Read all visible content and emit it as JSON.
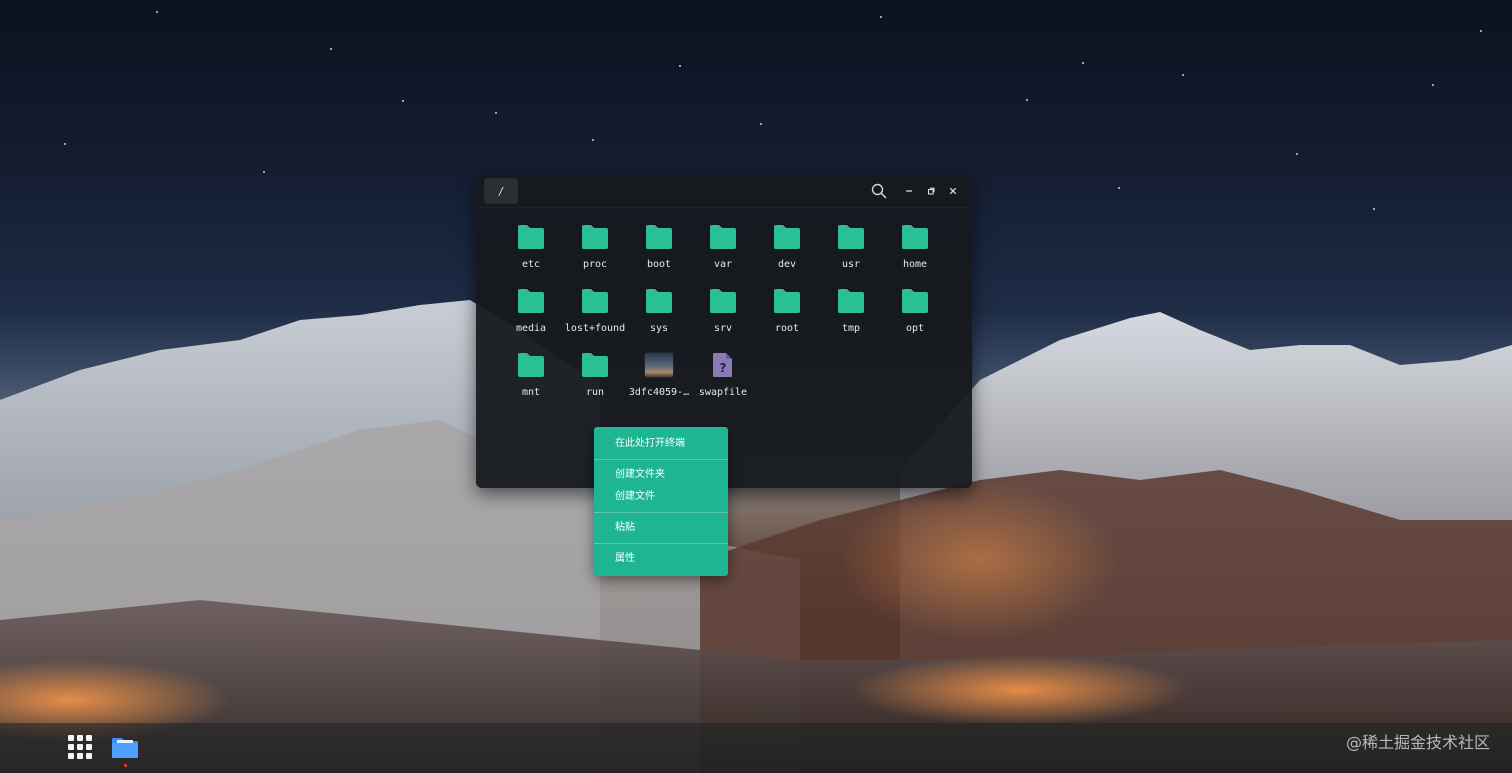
{
  "colors": {
    "accent": "#1DB592",
    "folder": "#2BBF95",
    "file_icon": "#8A7BB8",
    "window_bg": "#16191D",
    "menu_text": "#FFFFFF"
  },
  "file_manager": {
    "path": "/",
    "controls": {
      "search_icon": "search-icon",
      "minimize_icon": "minimize-icon",
      "restore_icon": "restore-icon",
      "close_icon": "close-icon"
    },
    "items": [
      {
        "name": "etc",
        "kind": "folder"
      },
      {
        "name": "proc",
        "kind": "folder"
      },
      {
        "name": "boot",
        "kind": "folder"
      },
      {
        "name": "var",
        "kind": "folder"
      },
      {
        "name": "dev",
        "kind": "folder"
      },
      {
        "name": "usr",
        "kind": "folder"
      },
      {
        "name": "home",
        "kind": "folder"
      },
      {
        "name": "media",
        "kind": "folder"
      },
      {
        "name": "lost+found",
        "kind": "folder"
      },
      {
        "name": "sys",
        "kind": "folder"
      },
      {
        "name": "srv",
        "kind": "folder"
      },
      {
        "name": "root",
        "kind": "folder"
      },
      {
        "name": "tmp",
        "kind": "folder"
      },
      {
        "name": "opt",
        "kind": "folder"
      },
      {
        "name": "mnt",
        "kind": "folder"
      },
      {
        "name": "run",
        "kind": "folder"
      },
      {
        "name": "3dfc4059-…",
        "kind": "image"
      },
      {
        "name": "swapfile",
        "kind": "unknown-file"
      }
    ]
  },
  "context_menu": {
    "items": [
      {
        "label": "在此处打开终端",
        "group": 0
      },
      {
        "label": "创建文件夹",
        "group": 1
      },
      {
        "label": "创建文件",
        "group": 1
      },
      {
        "label": "粘贴",
        "group": 2
      },
      {
        "label": "属性",
        "group": 3
      }
    ]
  },
  "taskbar": {
    "launcher_icon": "app-grid-icon",
    "dock_apps": [
      {
        "name": "files",
        "icon": "folder-icon",
        "running": true
      }
    ]
  },
  "watermark": "@稀土掘金技术社区"
}
